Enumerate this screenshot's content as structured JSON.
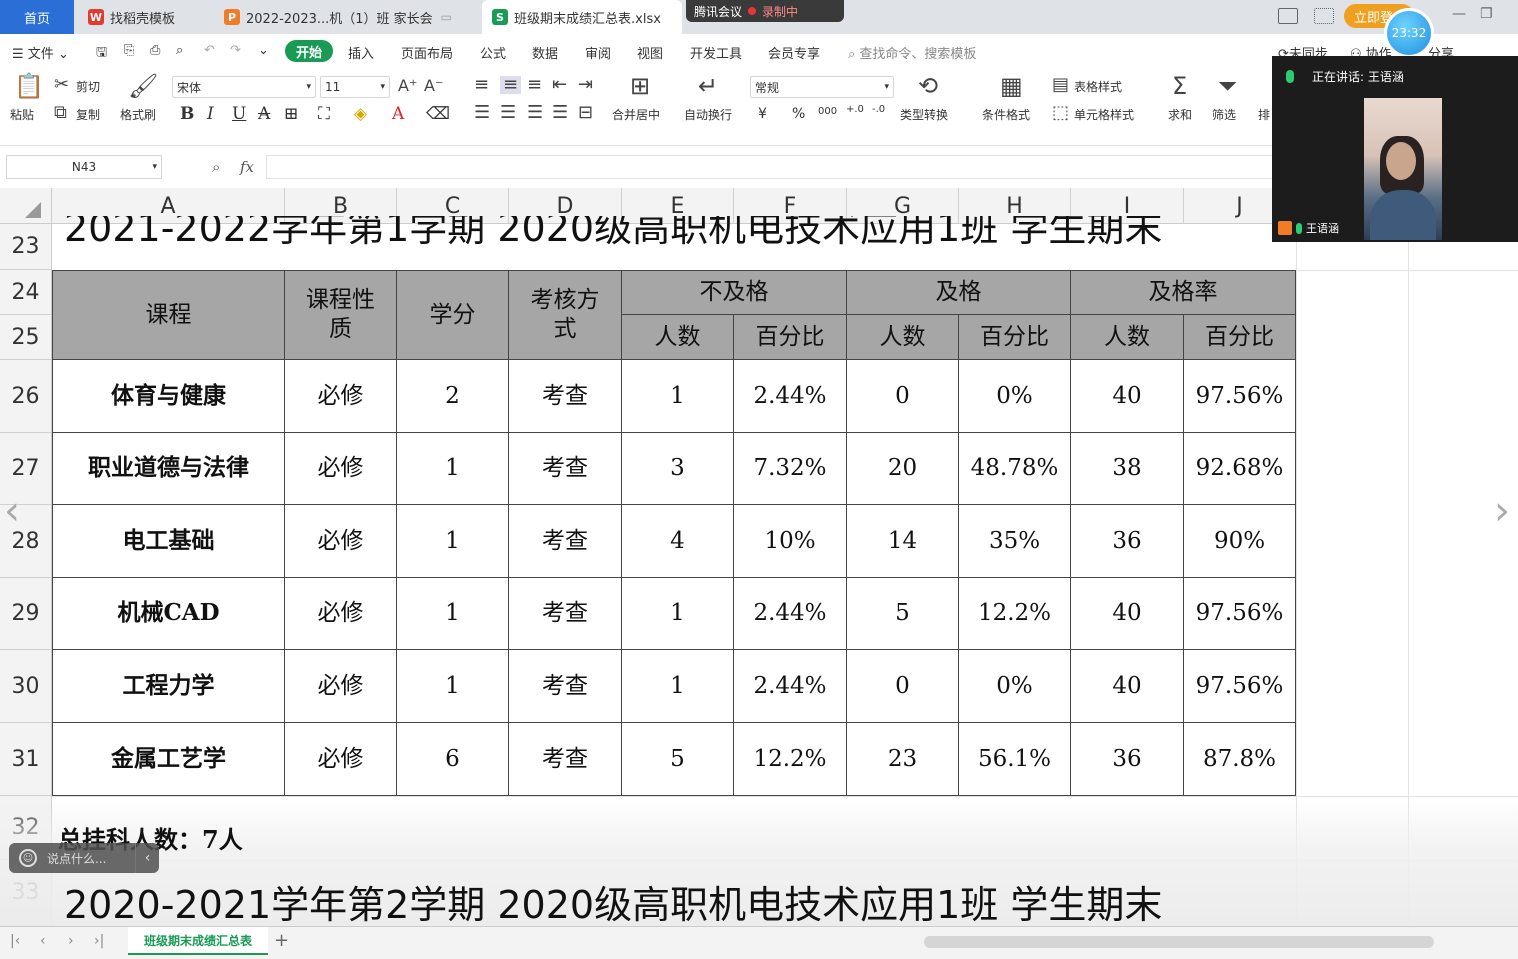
{
  "tabs": {
    "home": "首页",
    "t1": "找稻壳模板",
    "t2": "2022-2023...机（1）班 家长会",
    "t3": "班级期末成绩汇总表.xlsx",
    "t1_icon": "W",
    "t2_icon": "P",
    "t3_icon": "S"
  },
  "meeting_bar": {
    "app": "腾讯会议",
    "recording": "录制中"
  },
  "topright": {
    "login": "立即登",
    "clock": "23:32"
  },
  "menu": {
    "file": "文件",
    "start": "开始",
    "items": [
      "插入",
      "页面布局",
      "公式",
      "数据",
      "审阅",
      "视图",
      "开发工具",
      "会员专享"
    ],
    "search": "查找命令、搜索模板",
    "unsynced": "未同步",
    "collab": "协作",
    "share": "分享"
  },
  "ribbon": {
    "paste": "粘贴",
    "cut": "剪切",
    "copy": "复制",
    "format_painter": "格式刷",
    "font_name": "宋体",
    "font_size": "11",
    "merge_center": "合并居中",
    "wrap": "自动换行",
    "number_format": "常规",
    "type_convert": "类型转换",
    "cond_format": "条件格式",
    "table_style": "表格样式",
    "cell_style": "单元格样式",
    "sum": "求和",
    "filter": "筛选",
    "sort": "排"
  },
  "formula": {
    "cell_ref": "N43",
    "fx": "fx",
    "value": ""
  },
  "columns": [
    "A",
    "B",
    "C",
    "D",
    "E",
    "F",
    "G",
    "H",
    "I",
    "J"
  ],
  "rows": [
    "23",
    "24",
    "25",
    "26",
    "27",
    "28",
    "29",
    "30",
    "31",
    "32",
    "33"
  ],
  "sheet": {
    "title_prev": "2021-2022学年第1学期 2020级高职机电技术应用1班 学生期末",
    "header": {
      "course": "课程",
      "nature": "课程性质",
      "credit": "学分",
      "exam": "考核方式",
      "fail": "不及格",
      "pass": "及格",
      "pass_rate": "及格率",
      "count": "人数",
      "percent": "百分比"
    },
    "data_rows": [
      {
        "course": "体育与健康",
        "nature": "必修",
        "credit": "2",
        "exam": "考查",
        "fail_n": "1",
        "fail_p": "2.44%",
        "pass_n": "0",
        "pass_p": "0%",
        "rate_n": "40",
        "rate_p": "97.56%"
      },
      {
        "course": "职业道德与法律",
        "nature": "必修",
        "credit": "1",
        "exam": "考查",
        "fail_n": "3",
        "fail_p": "7.32%",
        "pass_n": "20",
        "pass_p": "48.78%",
        "rate_n": "38",
        "rate_p": "92.68%"
      },
      {
        "course": "电工基础",
        "nature": "必修",
        "credit": "1",
        "exam": "考查",
        "fail_n": "4",
        "fail_p": "10%",
        "pass_n": "14",
        "pass_p": "35%",
        "rate_n": "36",
        "rate_p": "90%"
      },
      {
        "course": "机械CAD",
        "nature": "必修",
        "credit": "1",
        "exam": "考查",
        "fail_n": "1",
        "fail_p": "2.44%",
        "pass_n": "5",
        "pass_p": "12.2%",
        "rate_n": "40",
        "rate_p": "97.56%"
      },
      {
        "course": "工程力学",
        "nature": "必修",
        "credit": "1",
        "exam": "考查",
        "fail_n": "1",
        "fail_p": "2.44%",
        "pass_n": "0",
        "pass_p": "0%",
        "rate_n": "40",
        "rate_p": "97.56%"
      },
      {
        "course": "金属工艺学",
        "nature": "必修",
        "credit": "6",
        "exam": "考查",
        "fail_n": "5",
        "fail_p": "12.2%",
        "pass_n": "23",
        "pass_p": "56.1%",
        "rate_n": "36",
        "rate_p": "87.8%"
      }
    ],
    "total_fail": "总挂科人数：7人",
    "title_next": "2020-2021学年第2学期 2020级高职机电技术应用1班 学生期末"
  },
  "chat": {
    "placeholder": "说点什么..."
  },
  "sheet_tab": "班级期末成绩汇总表",
  "meeting_panel": {
    "speaking": "正在讲话: 王语涵",
    "name": "王语涵"
  }
}
